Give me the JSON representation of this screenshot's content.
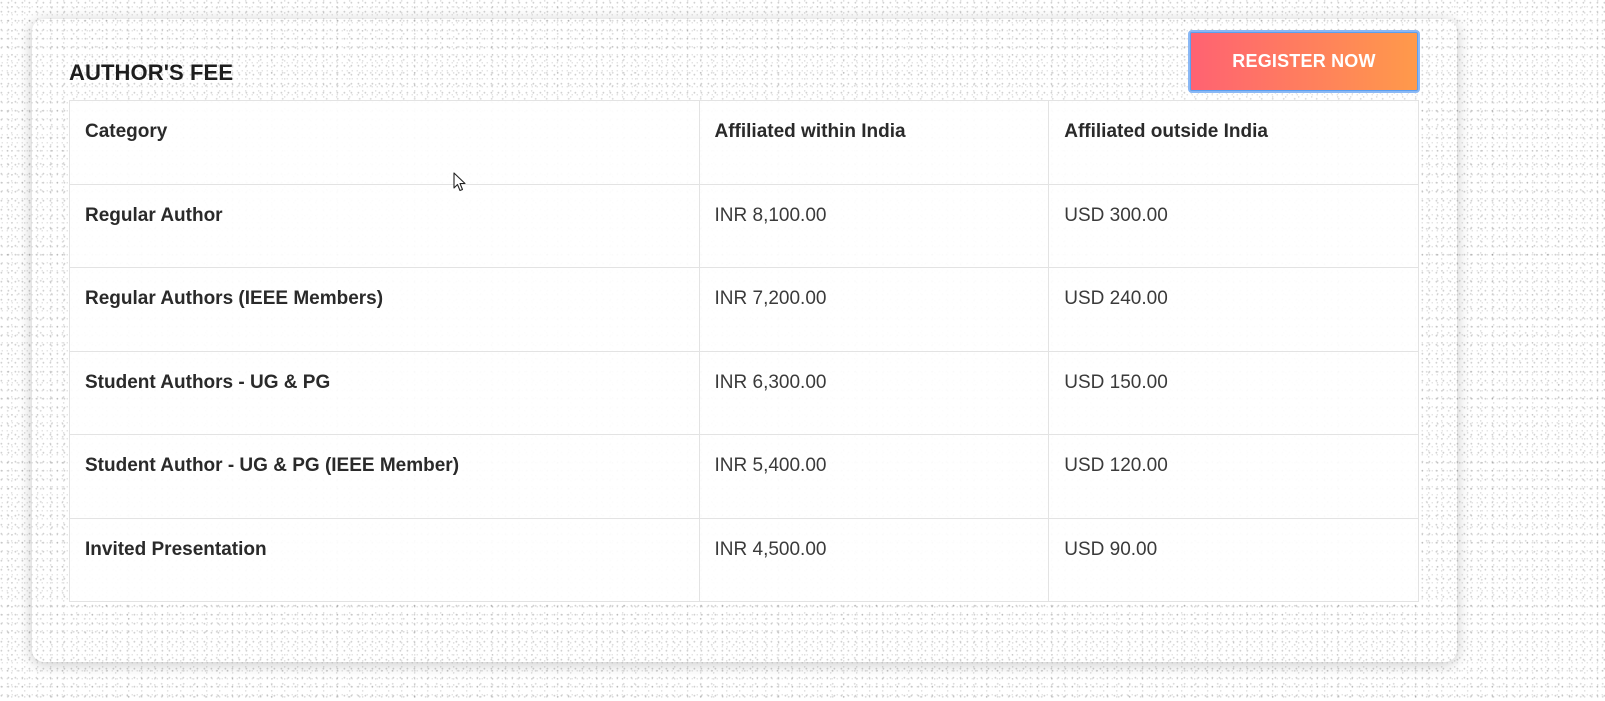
{
  "section": {
    "title": "AUTHOR'S FEE",
    "register_label": "REGISTER NOW"
  },
  "table": {
    "headers": [
      "Category",
      "Affiliated within India",
      "Affiliated outside India"
    ],
    "rows": [
      {
        "category": "Regular Author",
        "india": "INR 8,100.00",
        "outside": "USD 300.00"
      },
      {
        "category": "Regular Authors (IEEE Members)",
        "india": "INR 7,200.00",
        "outside": "USD 240.00"
      },
      {
        "category": "Student Authors - UG & PG",
        "india": "INR 6,300.00",
        "outside": "USD 150.00"
      },
      {
        "category": "Student Author - UG & PG (IEEE Member)",
        "india": "INR 5,400.00",
        "outside": "USD 120.00"
      },
      {
        "category": "Invited Presentation",
        "india": "INR 4,500.00",
        "outside": "USD 90.00"
      }
    ]
  },
  "colors": {
    "button_gradient_start": "#ff6272",
    "button_gradient_end": "#ff9a4a",
    "button_focus_border": "#8ab8f5"
  },
  "icons": {
    "cursor": "mouse-pointer-icon"
  }
}
